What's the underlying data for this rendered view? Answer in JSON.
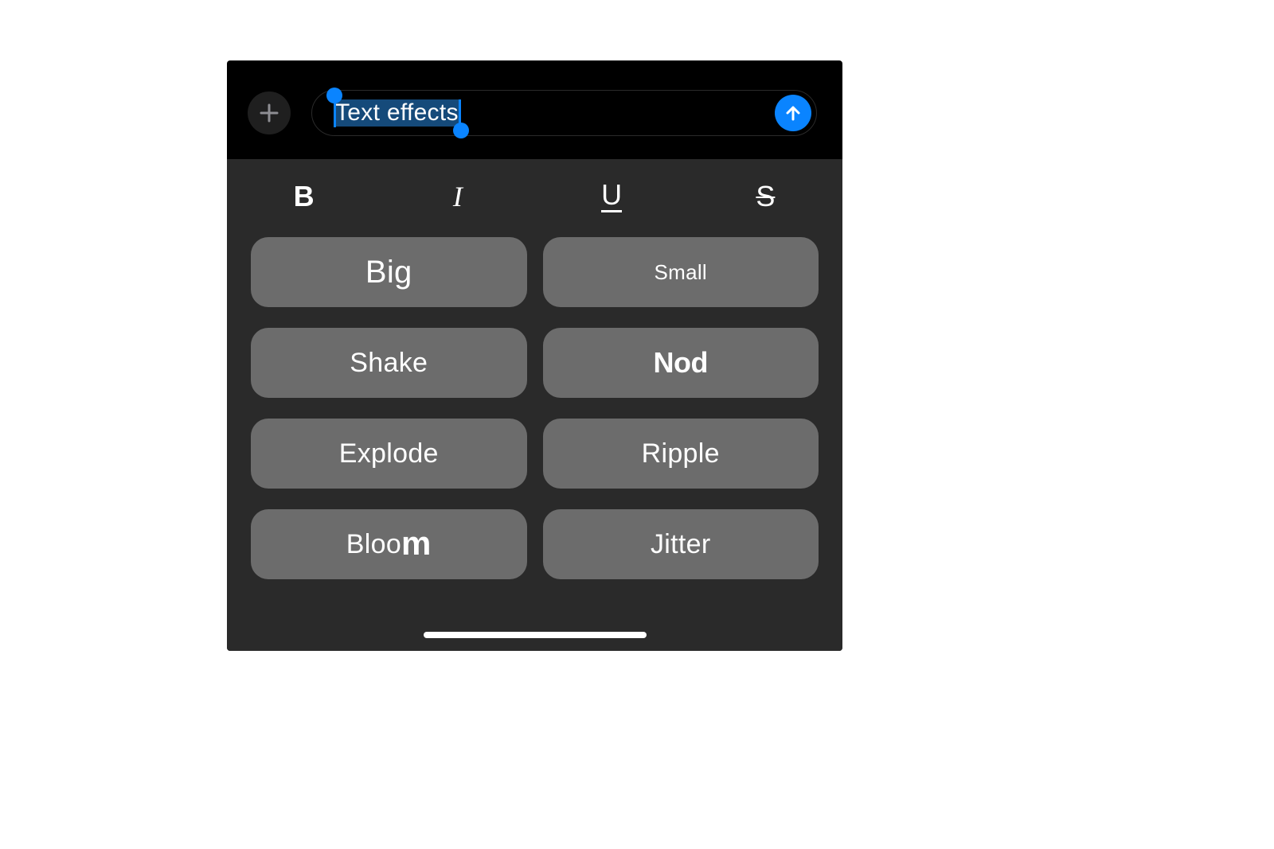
{
  "compose": {
    "text": "Text effects"
  },
  "format": {
    "bold": "B",
    "italic": "I",
    "underline": "U",
    "strike": "S"
  },
  "effects": {
    "big": "Big",
    "small": "Small",
    "shake": "Shake",
    "nod": "Nod",
    "explode": "Explode",
    "ripple": "Ripple",
    "bloom_prefix": "Bloo",
    "bloom_suffix": "m",
    "jitter": "Jitter"
  },
  "colors": {
    "accent": "#0a84ff",
    "panel": "#2a2a2a",
    "button": "#6c6c6c"
  }
}
